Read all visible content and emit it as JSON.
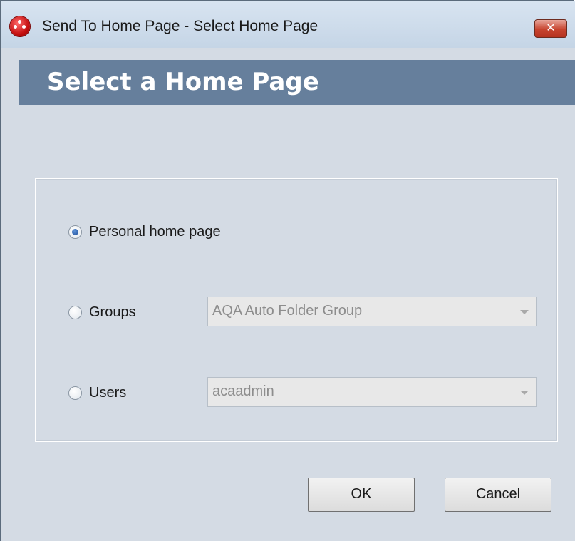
{
  "window": {
    "title": "Send To Home Page - Select Home Page",
    "close_label": "✕"
  },
  "header": {
    "title": "Select a Home Page"
  },
  "options": {
    "selected": "personal",
    "personal": {
      "label": "Personal home page"
    },
    "groups": {
      "label": "Groups",
      "dropdown_value": "AQA Auto Folder Group"
    },
    "users": {
      "label": "Users",
      "dropdown_value": "acaadmin"
    }
  },
  "buttons": {
    "ok_label": "OK",
    "cancel_label": "Cancel"
  },
  "icons": {
    "app": "app-logo-icon",
    "close": "close-icon",
    "dropdown": "chevron-down-icon"
  },
  "colors": {
    "header_banner": "#667f9c",
    "close_button": "#c7442f",
    "dialog_background": "#d4dbe4"
  }
}
